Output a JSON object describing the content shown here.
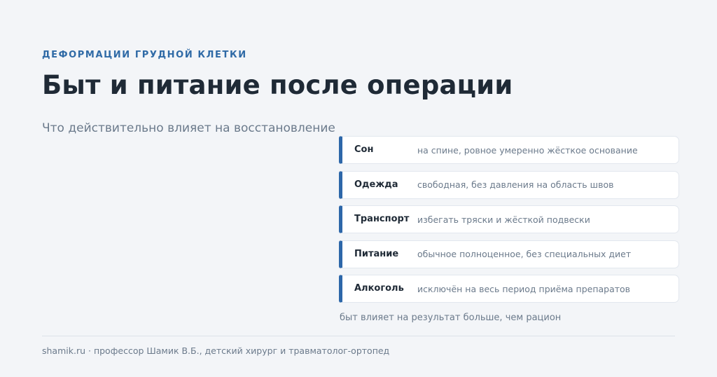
{
  "header": {
    "kicker": "ДЕФОРМАЦИИ ГРУДНОЙ КЛЕТКИ",
    "title": "Быт и питание после операции",
    "subtitle": "Что действительно влияет на восстановление"
  },
  "cards": [
    {
      "label": "Сон",
      "value": "на спине, ровное умеренно жёсткое основание"
    },
    {
      "label": "Одежда",
      "value": "свободная, без давления на область швов"
    },
    {
      "label": "Транспорт",
      "value": "избегать тряски и жёсткой подвески"
    },
    {
      "label": "Питание",
      "value": "обычное полноценное, без специальных диет"
    },
    {
      "label": "Алкоголь",
      "value": "исключён на весь период приёма препаратов"
    }
  ],
  "note": "быт влияет на результат больше, чем рацион",
  "footer": "shamik.ru · профессор Шамик В.Б., детский хирург и травматолог-ортопед",
  "colors": {
    "accent": "#2d67a9",
    "kicker": "#2f6aa6",
    "title": "#1f2a36",
    "muted": "#6b7a8b",
    "background": "#f3f5f8"
  }
}
